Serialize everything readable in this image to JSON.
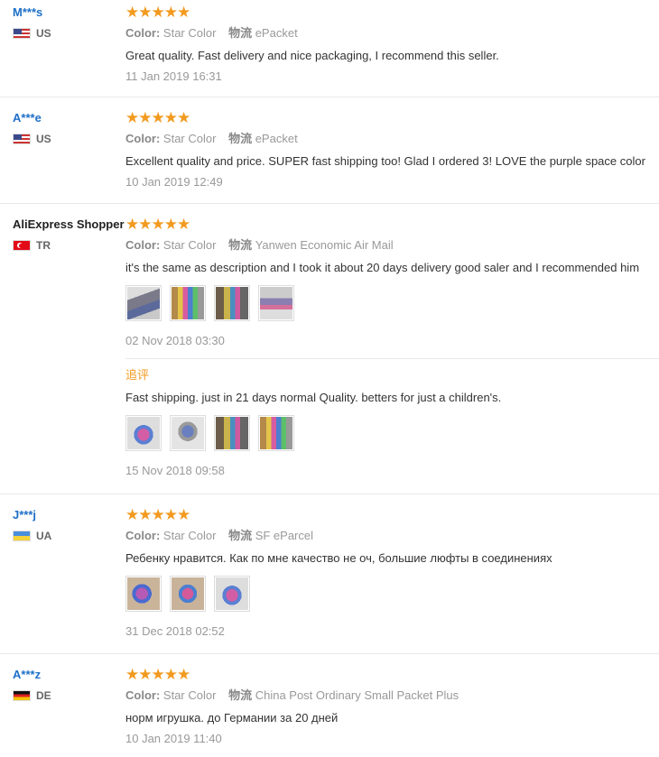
{
  "reviews": [
    {
      "name": "M***s",
      "country": "US",
      "flag": "us-flag-icon",
      "stars": "★★★★★",
      "color_label": "Color:",
      "color_value": "Star Color",
      "ship_label": "物流",
      "ship_value": "ePacket",
      "text": "Great quality. Fast delivery and nice packaging, I recommend this seller.",
      "date": "11 Jan 2019 16:31"
    },
    {
      "name": "A***e",
      "country": "US",
      "flag": "us-flag-icon",
      "stars": "★★★★★",
      "color_label": "Color:",
      "color_value": "Star Color",
      "ship_label": "物流",
      "ship_value": "ePacket",
      "text": "Excellent quality and price. SUPER fast shipping too! Glad I ordered 3! LOVE the purple space color",
      "date": "10 Jan 2019 12:49"
    },
    {
      "name": "AliExpress Shopper",
      "country": "TR",
      "flag": "turkey-flag-icon",
      "stars": "★★★★★",
      "color_label": "Color:",
      "color_value": "Star Color",
      "ship_label": "物流",
      "ship_value": "Yanwen Economic Air Mail",
      "text": "it's the same as description and I took it about 20 days delivery good saler and I recommended him",
      "date": "02 Nov 2018 03:30",
      "followup": {
        "title": "追评",
        "text": "Fast shipping. just in 21 days normal Quality. betters for just a children's.",
        "date": "15 Nov 2018 09:58"
      }
    },
    {
      "name": "J***j",
      "country": "UA",
      "flag": "ukraine-flag-icon",
      "stars": "★★★★★",
      "color_label": "Color:",
      "color_value": "Star Color",
      "ship_label": "物流",
      "ship_value": "SF eParcel",
      "text": "Ребенку нравится. Как по мне качество не оч, большие люфты в соединениях",
      "date": "31 Dec 2018 02:52"
    },
    {
      "name": "A***z",
      "country": "DE",
      "flag": "germany-flag-icon",
      "stars": "★★★★★",
      "color_label": "Color:",
      "color_value": "Star Color",
      "ship_label": "物流",
      "ship_value": "China Post Ordinary Small Packet Plus",
      "text": "норм игрушка. до Германии за 20 дней",
      "date": "10 Jan 2019 11:40"
    }
  ],
  "colors": {
    "star": "#f29a1f",
    "username": "#1d6fc7",
    "followup": "#f29a1f"
  }
}
